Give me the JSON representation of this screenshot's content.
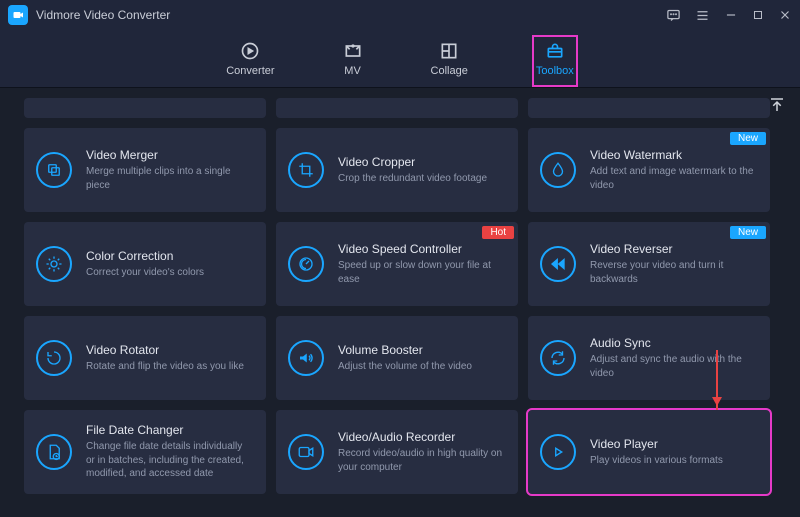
{
  "app": {
    "title": "Vidmore Video Converter"
  },
  "tabs": [
    {
      "id": "converter",
      "label": "Converter"
    },
    {
      "id": "mv",
      "label": "MV"
    },
    {
      "id": "collage",
      "label": "Collage"
    },
    {
      "id": "toolbox",
      "label": "Toolbox",
      "active": true,
      "highlight": true
    }
  ],
  "badges": {
    "new": "New",
    "hot": "Hot"
  },
  "cards": [
    {
      "id": "video-merger",
      "title": "Video Merger",
      "desc": "Merge multiple clips into a single piece"
    },
    {
      "id": "video-cropper",
      "title": "Video Cropper",
      "desc": "Crop the redundant video footage"
    },
    {
      "id": "video-watermark",
      "title": "Video Watermark",
      "desc": "Add text and image watermark to the video",
      "badge": "new"
    },
    {
      "id": "color-correction",
      "title": "Color Correction",
      "desc": "Correct your video's colors"
    },
    {
      "id": "video-speed",
      "title": "Video Speed Controller",
      "desc": "Speed up or slow down your file at ease",
      "badge": "hot"
    },
    {
      "id": "video-reverser",
      "title": "Video Reverser",
      "desc": "Reverse your video and turn it backwards",
      "badge": "new"
    },
    {
      "id": "video-rotator",
      "title": "Video Rotator",
      "desc": "Rotate and flip the video as you like"
    },
    {
      "id": "volume-booster",
      "title": "Volume Booster",
      "desc": "Adjust the volume of the video"
    },
    {
      "id": "audio-sync",
      "title": "Audio Sync",
      "desc": "Adjust and sync the audio with the video"
    },
    {
      "id": "file-date",
      "title": "File Date Changer",
      "desc": "Change file date details individually or in batches, including the created, modified, and accessed date"
    },
    {
      "id": "av-recorder",
      "title": "Video/Audio Recorder",
      "desc": "Record video/audio in high quality on your computer"
    },
    {
      "id": "video-player",
      "title": "Video Player",
      "desc": "Play videos in various formats",
      "highlight": true
    }
  ],
  "icons": {
    "video-merger": "layers",
    "video-cropper": "crop",
    "video-watermark": "drop",
    "color-correction": "sun",
    "video-speed": "speed",
    "video-reverser": "rewind",
    "video-rotator": "rotate",
    "volume-booster": "volume",
    "audio-sync": "sync",
    "file-date": "file-clock",
    "av-recorder": "record",
    "video-player": "play"
  }
}
